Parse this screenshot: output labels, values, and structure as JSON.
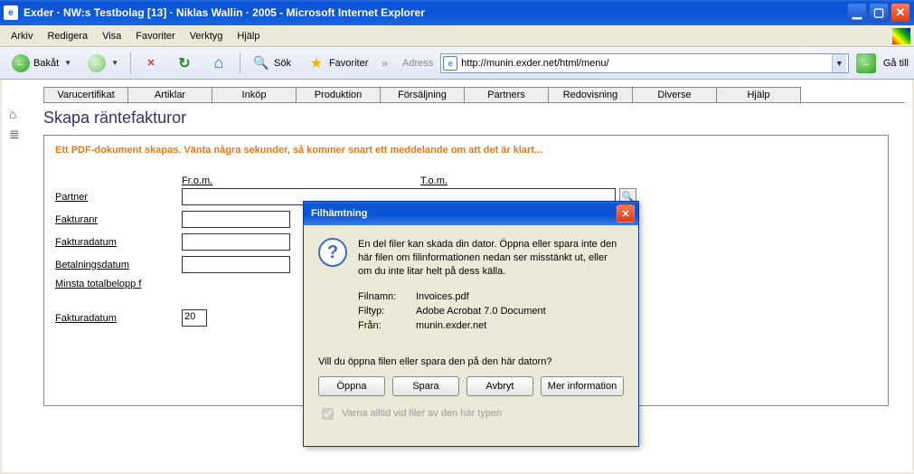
{
  "window": {
    "title": "Exder · NW:s Testbolag [13] · Niklas Wallin · 2005 - Microsoft Internet Explorer"
  },
  "menu": {
    "arkiv": "Arkiv",
    "redigera": "Redigera",
    "visa": "Visa",
    "favoriter": "Favoriter",
    "verktyg": "Verktyg",
    "hjalp": "Hjälp"
  },
  "toolbar": {
    "back": "Bakåt",
    "search": "Sök",
    "favorites": "Favoriter",
    "address_label": "Adress",
    "url": "http://munin.exder.net/html/menu/",
    "go": "Gå till"
  },
  "tabs": {
    "varucertifikat": "Varucertifikat",
    "artiklar": "Artiklar",
    "inkop": "Inköp",
    "produktion": "Produktion",
    "forsaljning": "Försäljning",
    "partners": "Partners",
    "redovisning": "Redovisning",
    "diverse": "Diverse",
    "hjalp": "Hjälp"
  },
  "page": {
    "title": "Skapa räntefakturor",
    "pdf_msg": "Ett PDF-dokument skapas. Vänta några sekunder, så kommer snart ett meddelande om att det är klart...",
    "col_from": "Fr.o.m.",
    "col_to": "T.o.m.",
    "labels": {
      "partner": "Partner",
      "fakturanr": "Fakturanr",
      "fakturadatum": "Fakturadatum",
      "betalningsdatum": "Betalningsdatum",
      "minsta": "Minsta totalbelopp f",
      "fakturadatum2": "Fakturadatum"
    },
    "fakturadatum2_value": "20"
  },
  "dialog": {
    "title": "Filhämtning",
    "warn": "En del filer kan skada din dator. Öppna eller spara inte den här filen om filinformationen nedan ser misstänkt ut, eller om du inte litar helt på dess källa.",
    "meta": {
      "filnamn_k": "Filnamn:",
      "filnamn_v": "Invoices.pdf",
      "filtyp_k": "Filtyp:",
      "filtyp_v": "Adobe Acrobat 7.0 Document",
      "fran_k": "Från:",
      "fran_v": "munin.exder.net"
    },
    "question": "Vill du öppna filen eller spara den på den här datorn?",
    "btn_open": "Öppna",
    "btn_save": "Spara",
    "btn_cancel": "Avbryt",
    "btn_more": "Mer information",
    "always_warn": "Varna alltid vid filer av den här typen"
  }
}
